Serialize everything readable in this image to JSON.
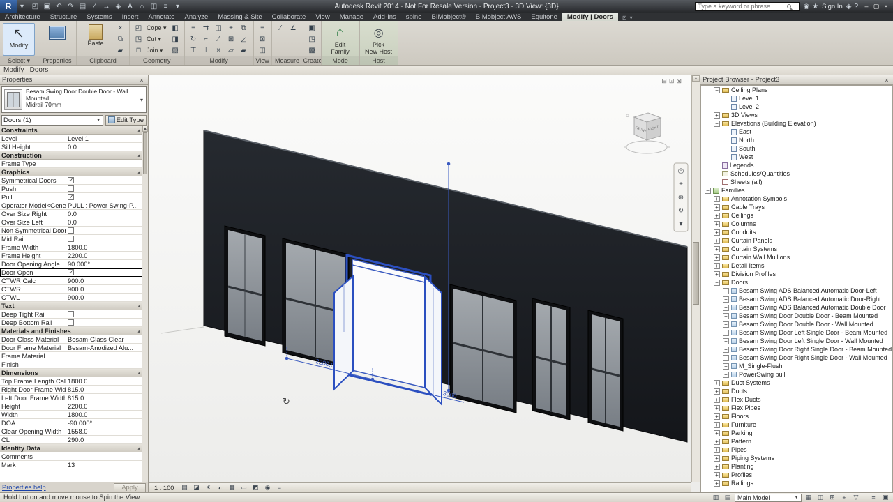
{
  "title_bar": {
    "title": "Autodesk Revit 2014 - Not For Resale Version -    Project3 - 3D View: {3D}",
    "search_placeholder": "Type a keyword or phrase",
    "sign_in": "Sign In",
    "qat": [
      {
        "n": "open-icon",
        "g": "◰"
      },
      {
        "n": "save-icon",
        "g": "▣"
      },
      {
        "n": "undo-icon",
        "g": "↶"
      },
      {
        "n": "redo-icon",
        "g": "↷"
      },
      {
        "n": "print-icon",
        "g": "▤"
      },
      {
        "n": "measure-icon",
        "g": "∕"
      },
      {
        "n": "aligned-dimension-icon",
        "g": "↔"
      },
      {
        "n": "tag-icon",
        "g": "◈"
      },
      {
        "n": "text-icon",
        "g": "A"
      },
      {
        "n": "default-3d-view-icon",
        "g": "⌂"
      },
      {
        "n": "section-icon",
        "g": "◫"
      },
      {
        "n": "thin-lines-icon",
        "g": "≡"
      },
      {
        "n": "switch-windows-icon",
        "g": "▾"
      }
    ],
    "right_icons": [
      {
        "n": "communication-center-icon",
        "g": "◉"
      },
      {
        "n": "favorites-icon",
        "g": "★"
      }
    ],
    "help_icons": [
      {
        "n": "exchange-apps-icon",
        "g": "◈"
      },
      {
        "n": "help-icon",
        "g": "?"
      }
    ],
    "window_icons": [
      {
        "n": "minimize-icon",
        "g": "–"
      },
      {
        "n": "maximize-icon",
        "g": "▢"
      },
      {
        "n": "close-icon",
        "g": "×"
      }
    ]
  },
  "ribbon": {
    "tabs": [
      {
        "label": "Architecture"
      },
      {
        "label": "Structure"
      },
      {
        "label": "Systems"
      },
      {
        "label": "Insert"
      },
      {
        "label": "Annotate"
      },
      {
        "label": "Analyze"
      },
      {
        "label": "Massing & Site"
      },
      {
        "label": "Collaborate"
      },
      {
        "label": "View"
      },
      {
        "label": "Manage"
      },
      {
        "label": "Add-Ins"
      },
      {
        "label": "spine"
      },
      {
        "label": "BIMobject®"
      },
      {
        "label": "BIMobject AWS"
      },
      {
        "label": "Equitone"
      },
      {
        "label": "Modify | Doors",
        "active": true
      }
    ],
    "panels": [
      {
        "label": "Select ▾",
        "items": [
          {
            "t": "big",
            "n": "modify-button",
            "icon": "modify",
            "label": "Modify",
            "active": true
          }
        ]
      },
      {
        "label": "Properties",
        "items": [
          {
            "t": "big",
            "n": "properties-button",
            "icon": "props",
            "label": ""
          }
        ]
      },
      {
        "label": "Clipboard",
        "items": [
          {
            "t": "big",
            "n": "paste-button",
            "icon": "paste",
            "label": "Paste"
          },
          {
            "t": "col",
            "icons": [
              {
                "n": "cut-to-clipboard-icon",
                "g": "×"
              },
              {
                "n": "copy-to-clipboard-icon",
                "g": "⧉"
              },
              {
                "n": "match-type-properties-icon",
                "g": "▰"
              }
            ]
          }
        ]
      },
      {
        "label": "Geometry",
        "items": [
          {
            "t": "menu",
            "rows": [
              {
                "n": "cope-menu",
                "g": "◰",
                "label": "Cope ▾"
              },
              {
                "n": "cut-menu",
                "g": "◳",
                "label": "Cut ▾"
              },
              {
                "n": "join-menu",
                "g": "⊓",
                "label": "Join ▾"
              }
            ]
          },
          {
            "t": "col",
            "icons": [
              {
                "n": "paint-icon",
                "g": "◧"
              },
              {
                "n": "split-face-icon",
                "g": "◨"
              },
              {
                "n": "demolish-icon",
                "g": "▨"
              }
            ]
          }
        ]
      },
      {
        "label": "Modify",
        "items": [
          {
            "t": "grid",
            "cols": 5,
            "icons": [
              {
                "n": "align-icon",
                "g": "≡"
              },
              {
                "n": "offset-icon",
                "g": "⇉"
              },
              {
                "n": "mirror-icon",
                "g": "◫"
              },
              {
                "n": "move-icon",
                "g": "+"
              },
              {
                "n": "copy-icon",
                "g": "⧉"
              },
              {
                "n": "rotate-icon",
                "g": "↻"
              },
              {
                "n": "trim-icon",
                "g": "⌐"
              },
              {
                "n": "split-icon",
                "g": "∕"
              },
              {
                "n": "array-icon",
                "g": "⊞"
              },
              {
                "n": "scale-icon",
                "g": "◿"
              },
              {
                "n": "pin-icon",
                "g": "⊤"
              },
              {
                "n": "unpin-icon",
                "g": "⊥"
              },
              {
                "n": "delete-icon",
                "g": "×"
              },
              {
                "n": "mirror-axis-icon",
                "g": "▱"
              },
              {
                "n": "match-icon",
                "g": "▰"
              }
            ]
          }
        ]
      },
      {
        "label": "View",
        "items": [
          {
            "t": "col",
            "icons": [
              {
                "n": "thin-lines-toggle-icon",
                "g": "≡"
              },
              {
                "n": "close-hidden-icon",
                "g": "⊠"
              },
              {
                "n": "switch-window-icon",
                "g": "◫"
              }
            ]
          }
        ]
      },
      {
        "label": "Measure",
        "items": [
          {
            "t": "grid",
            "cols": 2,
            "icons": [
              {
                "n": "measure-between-icon",
                "g": "∕"
              },
              {
                "n": "angular-dimension-icon",
                "g": "∠"
              }
            ]
          }
        ]
      },
      {
        "label": "Create",
        "items": [
          {
            "t": "col",
            "icons": [
              {
                "n": "create-group-icon",
                "g": "▣"
              },
              {
                "n": "create-similar-icon",
                "g": "◳"
              },
              {
                "n": "legend-component-icon",
                "g": "▩"
              }
            ]
          }
        ]
      },
      {
        "label": "Mode",
        "ctx": true,
        "items": [
          {
            "t": "big",
            "n": "edit-family-button",
            "icon": "editfam",
            "label": "Edit\nFamily"
          }
        ]
      },
      {
        "label": "Host",
        "ctx": true,
        "items": [
          {
            "t": "big",
            "n": "pick-new-host-button",
            "icon": "pickhost",
            "label": "Pick\nNew Host"
          }
        ]
      }
    ]
  },
  "options_bar": {
    "label": "Modify | Doors"
  },
  "properties": {
    "header": "Properties",
    "type_name": "Besam Swing Door Double Door - Wall Mounted",
    "type_sub": "Midrail 70mm",
    "filter": "Doors (1)",
    "edit_type": "Edit Type",
    "help": "Properties help",
    "apply": "Apply",
    "rows": [
      {
        "k": "section",
        "label": "Constraints"
      },
      {
        "k": "val",
        "label": "Level",
        "value": "Level 1"
      },
      {
        "k": "val",
        "label": "Sill Height",
        "value": "0.0"
      },
      {
        "k": "section",
        "label": "Construction"
      },
      {
        "k": "val",
        "label": "Frame Type",
        "value": ""
      },
      {
        "k": "section",
        "label": "Graphics"
      },
      {
        "k": "check",
        "label": "Symmetrical Doors",
        "checked": true
      },
      {
        "k": "check",
        "label": "Push",
        "checked": false
      },
      {
        "k": "check",
        "label": "Pull",
        "checked": true
      },
      {
        "k": "val",
        "label": "Operator Model<Generi...",
        "value": "PULL : Power Swing-P..."
      },
      {
        "k": "val",
        "label": "Over Size Right",
        "value": "0.0"
      },
      {
        "k": "val",
        "label": "Over Size Left",
        "value": "0.0"
      },
      {
        "k": "check",
        "label": "Non Symmetrical Doors",
        "checked": false
      },
      {
        "k": "check",
        "label": "Mid Rail",
        "checked": false
      },
      {
        "k": "val",
        "label": "Frame Width",
        "value": "1800.0"
      },
      {
        "k": "val",
        "label": "Frame Height",
        "value": "2200.0"
      },
      {
        "k": "val",
        "label": "Door Opening Angle",
        "value": "90.000°"
      },
      {
        "k": "check",
        "label": "Door Open",
        "checked": true,
        "selected": true
      },
      {
        "k": "val",
        "label": "CTWR Calc",
        "value": "900.0"
      },
      {
        "k": "val",
        "label": "CTWR",
        "value": "900.0"
      },
      {
        "k": "val",
        "label": "CTWL",
        "value": "900.0"
      },
      {
        "k": "section",
        "label": "Text"
      },
      {
        "k": "check",
        "label": "Deep Tight Rail",
        "checked": false
      },
      {
        "k": "check",
        "label": "Deep Bottom Rail",
        "checked": false
      },
      {
        "k": "section",
        "label": "Materials and Finishes"
      },
      {
        "k": "val",
        "label": "Door Glass Material",
        "value": "Besam-Glass Clear"
      },
      {
        "k": "val",
        "label": "Door Frame Material",
        "value": "Besam-Anodized Alu..."
      },
      {
        "k": "val",
        "label": "Frame Material",
        "value": ""
      },
      {
        "k": "val",
        "label": "Finish",
        "value": ""
      },
      {
        "k": "section",
        "label": "Dimensions"
      },
      {
        "k": "val",
        "label": "Top Frame Length Calc",
        "value": "1800.0"
      },
      {
        "k": "val",
        "label": "Right Door Frame Width",
        "value": "815.0"
      },
      {
        "k": "val",
        "label": "Left Door Frame Width",
        "value": "815.0"
      },
      {
        "k": "val",
        "label": "Height",
        "value": "2200.0"
      },
      {
        "k": "val",
        "label": "Width",
        "value": "1800.0"
      },
      {
        "k": "val",
        "label": "DOA",
        "value": "-90.000°"
      },
      {
        "k": "val",
        "label": "Clear Opening Width",
        "value": "1558.0"
      },
      {
        "k": "val",
        "label": "CL",
        "value": "290.0"
      },
      {
        "k": "section",
        "label": "Identity Data"
      },
      {
        "k": "val",
        "label": "Comments",
        "value": ""
      },
      {
        "k": "val",
        "label": "Mark",
        "value": "13"
      }
    ]
  },
  "viewport": {
    "dim_width": "2200.0",
    "dim_height": "3000",
    "viewcube_front": "FRONT",
    "viewcube_right": "RIGHT",
    "scale": "1 : 100",
    "corner_icons": [
      {
        "n": "viewport-minimize-icon",
        "g": "⊟"
      },
      {
        "n": "viewport-restore-icon",
        "g": "⊡"
      },
      {
        "n": "viewport-close-icon",
        "g": "⊠"
      }
    ],
    "navbar_icons": [
      {
        "n": "steering-wheel-icon",
        "g": "◎"
      },
      {
        "n": "pan-icon",
        "g": "+"
      },
      {
        "n": "zoom-icon",
        "g": "⊕"
      },
      {
        "n": "orbit-icon",
        "g": "↻"
      },
      {
        "n": "navbar-more-icon",
        "g": "▾"
      }
    ],
    "viewbar_icons": [
      {
        "n": "detail-level-icon",
        "g": "▤"
      },
      {
        "n": "visual-style-icon",
        "g": "◪"
      },
      {
        "n": "sun-path-icon",
        "g": "☀"
      },
      {
        "n": "shadows-icon",
        "g": "◐"
      },
      {
        "n": "crop-view-icon",
        "g": "▦"
      },
      {
        "n": "show-crop-icon",
        "g": "▭"
      },
      {
        "n": "temporary-hide-icon",
        "g": "◩"
      },
      {
        "n": "reveal-hidden-icon",
        "g": "◉"
      },
      {
        "n": "analysis-display-icon",
        "g": "≡"
      }
    ]
  },
  "project_browser": {
    "title": "Project Browser - Project3",
    "items": [
      {
        "label": "Ceiling Plans",
        "indent": 1,
        "box": "minus",
        "icon": "cat"
      },
      {
        "label": "Level 1",
        "indent": 2,
        "icon": "view"
      },
      {
        "label": "Level 2",
        "indent": 2,
        "icon": "view"
      },
      {
        "label": "3D Views",
        "indent": 1,
        "box": "plus",
        "icon": "cat"
      },
      {
        "label": "Elevations (Building Elevation)",
        "indent": 1,
        "box": "minus",
        "icon": "cat"
      },
      {
        "label": "East",
        "indent": 2,
        "icon": "view"
      },
      {
        "label": "North",
        "indent": 2,
        "icon": "view"
      },
      {
        "label": "South",
        "indent": 2,
        "icon": "view"
      },
      {
        "label": "West",
        "indent": 2,
        "icon": "view"
      },
      {
        "label": "Legends",
        "indent": 1,
        "icon": "legend"
      },
      {
        "label": "Schedules/Quantities",
        "indent": 1,
        "icon": "sched"
      },
      {
        "label": "Sheets (all)",
        "indent": 1,
        "icon": "sheet"
      },
      {
        "label": "Families",
        "indent": 0,
        "box": "minus",
        "icon": "fam"
      },
      {
        "label": "Annotation Symbols",
        "indent": 1,
        "box": "plus",
        "icon": "cat2"
      },
      {
        "label": "Cable Trays",
        "indent": 1,
        "box": "plus",
        "icon": "cat2"
      },
      {
        "label": "Ceilings",
        "indent": 1,
        "box": "plus",
        "icon": "cat2"
      },
      {
        "label": "Columns",
        "indent": 1,
        "box": "plus",
        "icon": "cat2"
      },
      {
        "label": "Conduits",
        "indent": 1,
        "box": "plus",
        "icon": "cat2"
      },
      {
        "label": "Curtain Panels",
        "indent": 1,
        "box": "plus",
        "icon": "cat2"
      },
      {
        "label": "Curtain Systems",
        "indent": 1,
        "box": "plus",
        "icon": "cat2"
      },
      {
        "label": "Curtain Wall Mullions",
        "indent": 1,
        "box": "plus",
        "icon": "cat2"
      },
      {
        "label": "Detail Items",
        "indent": 1,
        "box": "plus",
        "icon": "cat2"
      },
      {
        "label": "Division Profiles",
        "indent": 1,
        "box": "plus",
        "icon": "cat2"
      },
      {
        "label": "Doors",
        "indent": 1,
        "box": "minus",
        "icon": "cat2"
      },
      {
        "label": "Besam Swing ADS Balanced Automatic Door-Left",
        "indent": 2,
        "box": "plus",
        "icon": "famtype"
      },
      {
        "label": "Besam Swing ADS Balanced Automatic Door-Right",
        "indent": 2,
        "box": "plus",
        "icon": "famtype"
      },
      {
        "label": "Besam Swing ADS Balanced Automatic Double Door",
        "indent": 2,
        "box": "plus",
        "icon": "famtype"
      },
      {
        "label": "Besam Swing Door Double Door - Beam Mounted",
        "indent": 2,
        "box": "plus",
        "icon": "famtype"
      },
      {
        "label": "Besam Swing Door Double Door - Wall Mounted",
        "indent": 2,
        "box": "plus",
        "icon": "famtype"
      },
      {
        "label": "Besam Swing Door Left Single Door - Beam Mounted",
        "indent": 2,
        "box": "plus",
        "icon": "famtype"
      },
      {
        "label": "Besam Swing Door Left Single Door - Wall Mounted",
        "indent": 2,
        "box": "plus",
        "icon": "famtype"
      },
      {
        "label": "Besam Swing Door Right Single Door - Beam Mounted",
        "indent": 2,
        "box": "plus",
        "icon": "famtype"
      },
      {
        "label": "Besam Swing Door Right Single Door - Wall Mounted",
        "indent": 2,
        "box": "plus",
        "icon": "famtype"
      },
      {
        "label": "M_Single-Flush",
        "indent": 2,
        "box": "plus",
        "icon": "famtype"
      },
      {
        "label": "PowerSwing pull",
        "indent": 2,
        "box": "plus",
        "icon": "famtype"
      },
      {
        "label": "Duct Systems",
        "indent": 1,
        "box": "plus",
        "icon": "cat2"
      },
      {
        "label": "Ducts",
        "indent": 1,
        "box": "plus",
        "icon": "cat2"
      },
      {
        "label": "Flex Ducts",
        "indent": 1,
        "box": "plus",
        "icon": "cat2"
      },
      {
        "label": "Flex Pipes",
        "indent": 1,
        "box": "plus",
        "icon": "cat2"
      },
      {
        "label": "Floors",
        "indent": 1,
        "box": "plus",
        "icon": "cat2"
      },
      {
        "label": "Furniture",
        "indent": 1,
        "box": "plus",
        "icon": "cat2"
      },
      {
        "label": "Parking",
        "indent": 1,
        "box": "plus",
        "icon": "cat2"
      },
      {
        "label": "Pattern",
        "indent": 1,
        "box": "plus",
        "icon": "cat2"
      },
      {
        "label": "Pipes",
        "indent": 1,
        "box": "plus",
        "icon": "cat2"
      },
      {
        "label": "Piping Systems",
        "indent": 1,
        "box": "plus",
        "icon": "cat2"
      },
      {
        "label": "Planting",
        "indent": 1,
        "box": "plus",
        "icon": "cat2"
      },
      {
        "label": "Profiles",
        "indent": 1,
        "box": "plus",
        "icon": "cat2"
      },
      {
        "label": "Railings",
        "indent": 1,
        "box": "plus",
        "icon": "cat2"
      }
    ]
  },
  "status_bar": {
    "message": "Hold button and move mouse to Spin the View.",
    "main_model": "Main Model",
    "pre_icons": [
      {
        "n": "worksets-icon",
        "g": "▥"
      },
      {
        "n": "editing-requests-icon",
        "g": "▤"
      }
    ],
    "post_icons": [
      {
        "n": "design-options-icon",
        "g": "▦"
      },
      {
        "n": "active-only-icon",
        "g": "◫"
      },
      {
        "n": "exclude-options-icon",
        "g": "⊞"
      },
      {
        "n": "press-drag-icon",
        "g": "+"
      },
      {
        "n": "filter-icon",
        "g": "▽"
      }
    ],
    "far_icons": [
      {
        "n": "background-process-icon",
        "g": "≡"
      },
      {
        "n": "selection-toggle-icon",
        "g": "▣"
      }
    ]
  },
  "colors": {
    "selection_blue": "#3b5bc0",
    "wall_dark": "#1d2024",
    "contextual_green": "#cdd6c2"
  }
}
